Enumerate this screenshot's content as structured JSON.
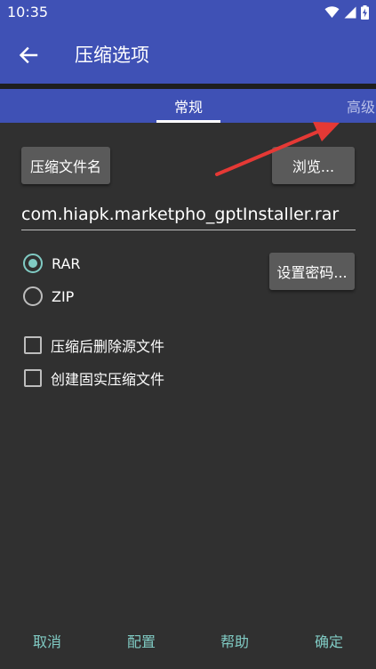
{
  "status_bar": {
    "time": "10:35"
  },
  "app_bar": {
    "title": "压缩选项",
    "back_icon": "arrow-left-icon"
  },
  "tabs": [
    {
      "label": "常规",
      "selected": true
    },
    {
      "label": "高级",
      "selected": false
    }
  ],
  "general": {
    "archive_name_button": "压缩文件名",
    "browse_button": "浏览...",
    "filename_value": "com.hiapk.marketpho_gptInstaller.rar",
    "format_options": [
      {
        "label": "RAR",
        "checked": true
      },
      {
        "label": "ZIP",
        "checked": false
      }
    ],
    "set_password_button": "设置密码...",
    "checkboxes": [
      {
        "label": "压缩后删除源文件",
        "checked": false
      },
      {
        "label": "创建固实压缩文件",
        "checked": false
      }
    ]
  },
  "bottom_buttons": {
    "cancel": "取消",
    "config": "配置",
    "help": "帮助",
    "ok": "确定"
  },
  "colors": {
    "primary": "#3f51b5",
    "background": "#303030",
    "accent": "#80cbc4",
    "annotation": "#e53935"
  }
}
